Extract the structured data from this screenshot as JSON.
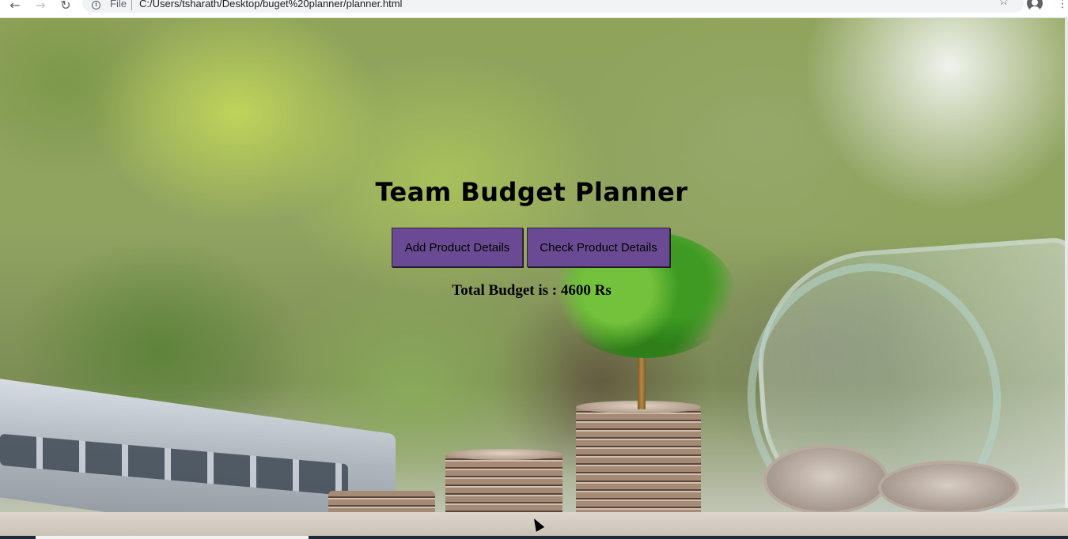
{
  "browser": {
    "protocol_label": "File",
    "url": "C:/Users/tsharath/Desktop/buget%20planner/planner.html",
    "icons": [
      "back-icon",
      "forward-icon",
      "reload-icon",
      "info-icon",
      "star-icon",
      "profile-icon",
      "menu-icon"
    ]
  },
  "page": {
    "title": "Team Budget Planner",
    "buttons": {
      "add_label": "Add Product Details",
      "check_label": "Check Product Details"
    },
    "total_budget_text": "Total Budget is : 4600 Rs"
  },
  "colors": {
    "button_bg": "#6a4b93",
    "title_text": "#000000"
  }
}
